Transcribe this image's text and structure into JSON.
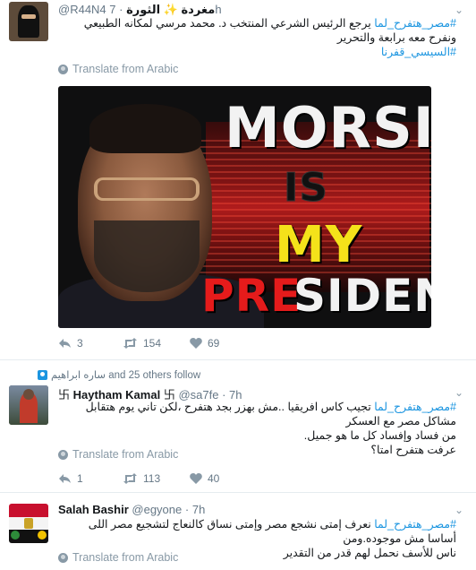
{
  "tweets": [
    {
      "name": "مغردة ✨ الثورة",
      "handle": "@R44N4",
      "time": "7h",
      "text_lines": [
        {
          "tag": "#مصر_هتفرح_لما",
          "text": " يرجع الرئيس الشرعي المنتخب د. محمد مرسي لمكانه الطبيعي"
        },
        {
          "tag": "",
          "text": "ونفرح معه برابعة والتحرير"
        },
        {
          "tag": "#السيسي_قفرنا",
          "text": ""
        }
      ],
      "translate": "Translate from Arabic",
      "media_text": {
        "morsi": "MORSI",
        "is": "IS",
        "my": "MY",
        "pre": "PRE",
        "sident": "SIDENT"
      },
      "reply_count": "3",
      "retweet_count": "154",
      "like_count": "69"
    },
    {
      "follow_context": "ساره ابراهيم and 25 others follow",
      "name": "Haytham Kamal",
      "swastika": "卐",
      "handle": "@sa7fe",
      "time": "7h",
      "text_lines": [
        {
          "tag": "#مصر_هتفرح_لما",
          "text": " تجيب كاس افريقيا ..مش بهزر بجد هتفرح ،لكن تاني يوم هتقابل مشاكل مصر مع العسكر"
        },
        {
          "tag": "",
          "text": "من فساد وإفساد كل ما هو جميل."
        },
        {
          "tag": "",
          "text": "عرفت هتفرح امتا؟"
        }
      ],
      "translate": "Translate from Arabic",
      "reply_count": "1",
      "retweet_count": "113",
      "like_count": "40"
    },
    {
      "name": "Salah Bashir",
      "handle": "@egyone",
      "time": "7h",
      "text_lines": [
        {
          "tag": "#مصر_هتفرح_لما",
          "text": " نعرف إمتى نشجع مصر وإمتى نساق كالنعاج لتشجيع مصر اللى أساسا مش موجوده.ومن"
        },
        {
          "tag": "",
          "text": "ناس للأسف نحمل لهم قدر من التقدير"
        }
      ],
      "translate": "Translate from Arabic"
    }
  ],
  "colors": {
    "link": "#1b95e0",
    "muted": "#8899a6",
    "text": "#14171a"
  },
  "icons": [
    "reply-icon",
    "retweet-icon",
    "heart-icon",
    "globe-icon",
    "chevron-down-icon",
    "person-icon"
  ]
}
